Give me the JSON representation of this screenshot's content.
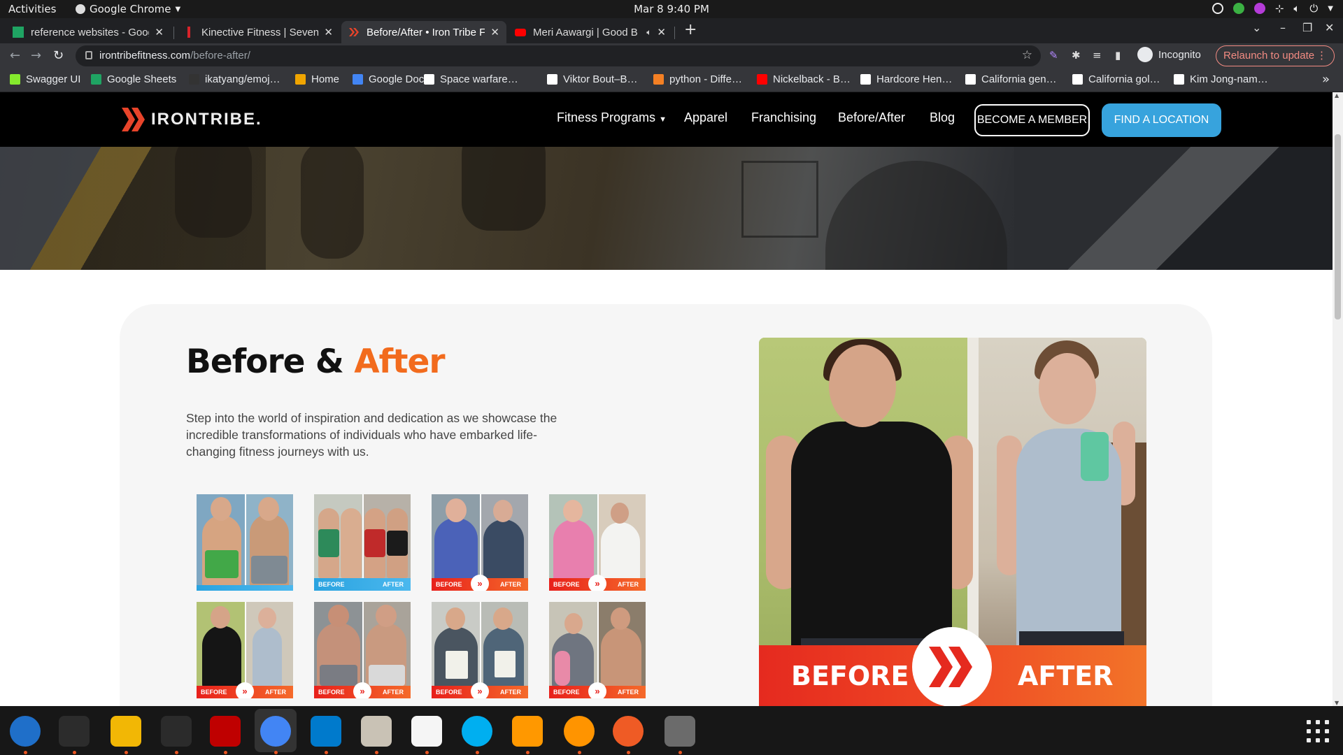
{
  "system": {
    "activities": "Activities",
    "app_name": "Google Chrome",
    "clock": "Mar 8  9:40 PM"
  },
  "tabs": [
    {
      "title": "reference websites - Goog",
      "favicon_color": "#1fa463"
    },
    {
      "title": "Kinective Fitness | Seven S",
      "favicon_color": "#d8232a"
    },
    {
      "title": "Before/After • Iron Tribe F",
      "favicon_color": "#e8442a",
      "active": true
    },
    {
      "title": "Meri Aawargi | Good B",
      "favicon_color": "#ff0000"
    }
  ],
  "omnibox": {
    "domain": "irontribefitness.com",
    "path": "/before-after/"
  },
  "profile": {
    "label": "Incognito"
  },
  "relaunch": "Relaunch to update",
  "bookmarks": [
    {
      "label": "Swagger UI",
      "color": "#85ea2d"
    },
    {
      "label": "Google Sheets",
      "color": "#1fa463"
    },
    {
      "label": "ikatyang/emoj…",
      "color": "#333333"
    },
    {
      "label": "Home",
      "color": "#f0a500"
    },
    {
      "label": "Google Docs",
      "color": "#4285f4"
    },
    {
      "label": "Space warfare…",
      "color": "#ffffff"
    },
    {
      "label": "Viktor Bout–B…",
      "color": "#ffffff"
    },
    {
      "label": "python - Diffe…",
      "color": "#f48024"
    },
    {
      "label": "Nickelback - B…",
      "color": "#ff0000"
    },
    {
      "label": "Hardcore Hen…",
      "color": "#ffffff"
    },
    {
      "label": "California gen…",
      "color": "#ffffff"
    },
    {
      "label": "California gol…",
      "color": "#ffffff"
    },
    {
      "label": "Kim Jong-nam…",
      "color": "#ffffff"
    }
  ],
  "site": {
    "logo_text": "IRONTRIBE.",
    "nav": [
      {
        "label": "Fitness Programs",
        "dropdown": true
      },
      {
        "label": "Apparel"
      },
      {
        "label": "Franchising"
      },
      {
        "label": "Before/After"
      },
      {
        "label": "Blog"
      }
    ],
    "member_button": "BECOME A MEMBER",
    "location_button": "FIND A LOCATION",
    "accent": "#f26b1d",
    "button_blue": "#37a3dd"
  },
  "main": {
    "heading_1": "Before & ",
    "heading_2": "After",
    "intro": "Step into the world of inspiration and dedication as we showcase the incredible transformations of individuals who have embarked life-changing fitness journeys with us.",
    "thumb_before": "BEFORE",
    "thumb_after": "AFTER",
    "featured_before": "BEFORE",
    "featured_after": "AFTER"
  },
  "dock": [
    {
      "name": "thunderbird-icon",
      "color": "#1f6fc9"
    },
    {
      "name": "terminal-icon",
      "color": "#2c2c2c"
    },
    {
      "name": "calculator-icon",
      "color": "#f2b705"
    },
    {
      "name": "system-monitor-icon",
      "color": "#2b2b2b"
    },
    {
      "name": "filezilla-icon",
      "color": "#bf0000"
    },
    {
      "name": "chrome-icon",
      "color": "#4285f4"
    },
    {
      "name": "vscode-icon",
      "color": "#007acc"
    },
    {
      "name": "files-icon",
      "color": "#c9c2b5"
    },
    {
      "name": "text-editor-icon",
      "color": "#f5f5f5"
    },
    {
      "name": "skype-icon",
      "color": "#00aff0"
    },
    {
      "name": "sublime-icon",
      "color": "#ff9800"
    },
    {
      "name": "firefox-dev-icon",
      "color": "#ff9400"
    },
    {
      "name": "postman-icon",
      "color": "#ef5b25"
    },
    {
      "name": "disk-icon",
      "color": "#6b6b6b"
    }
  ]
}
